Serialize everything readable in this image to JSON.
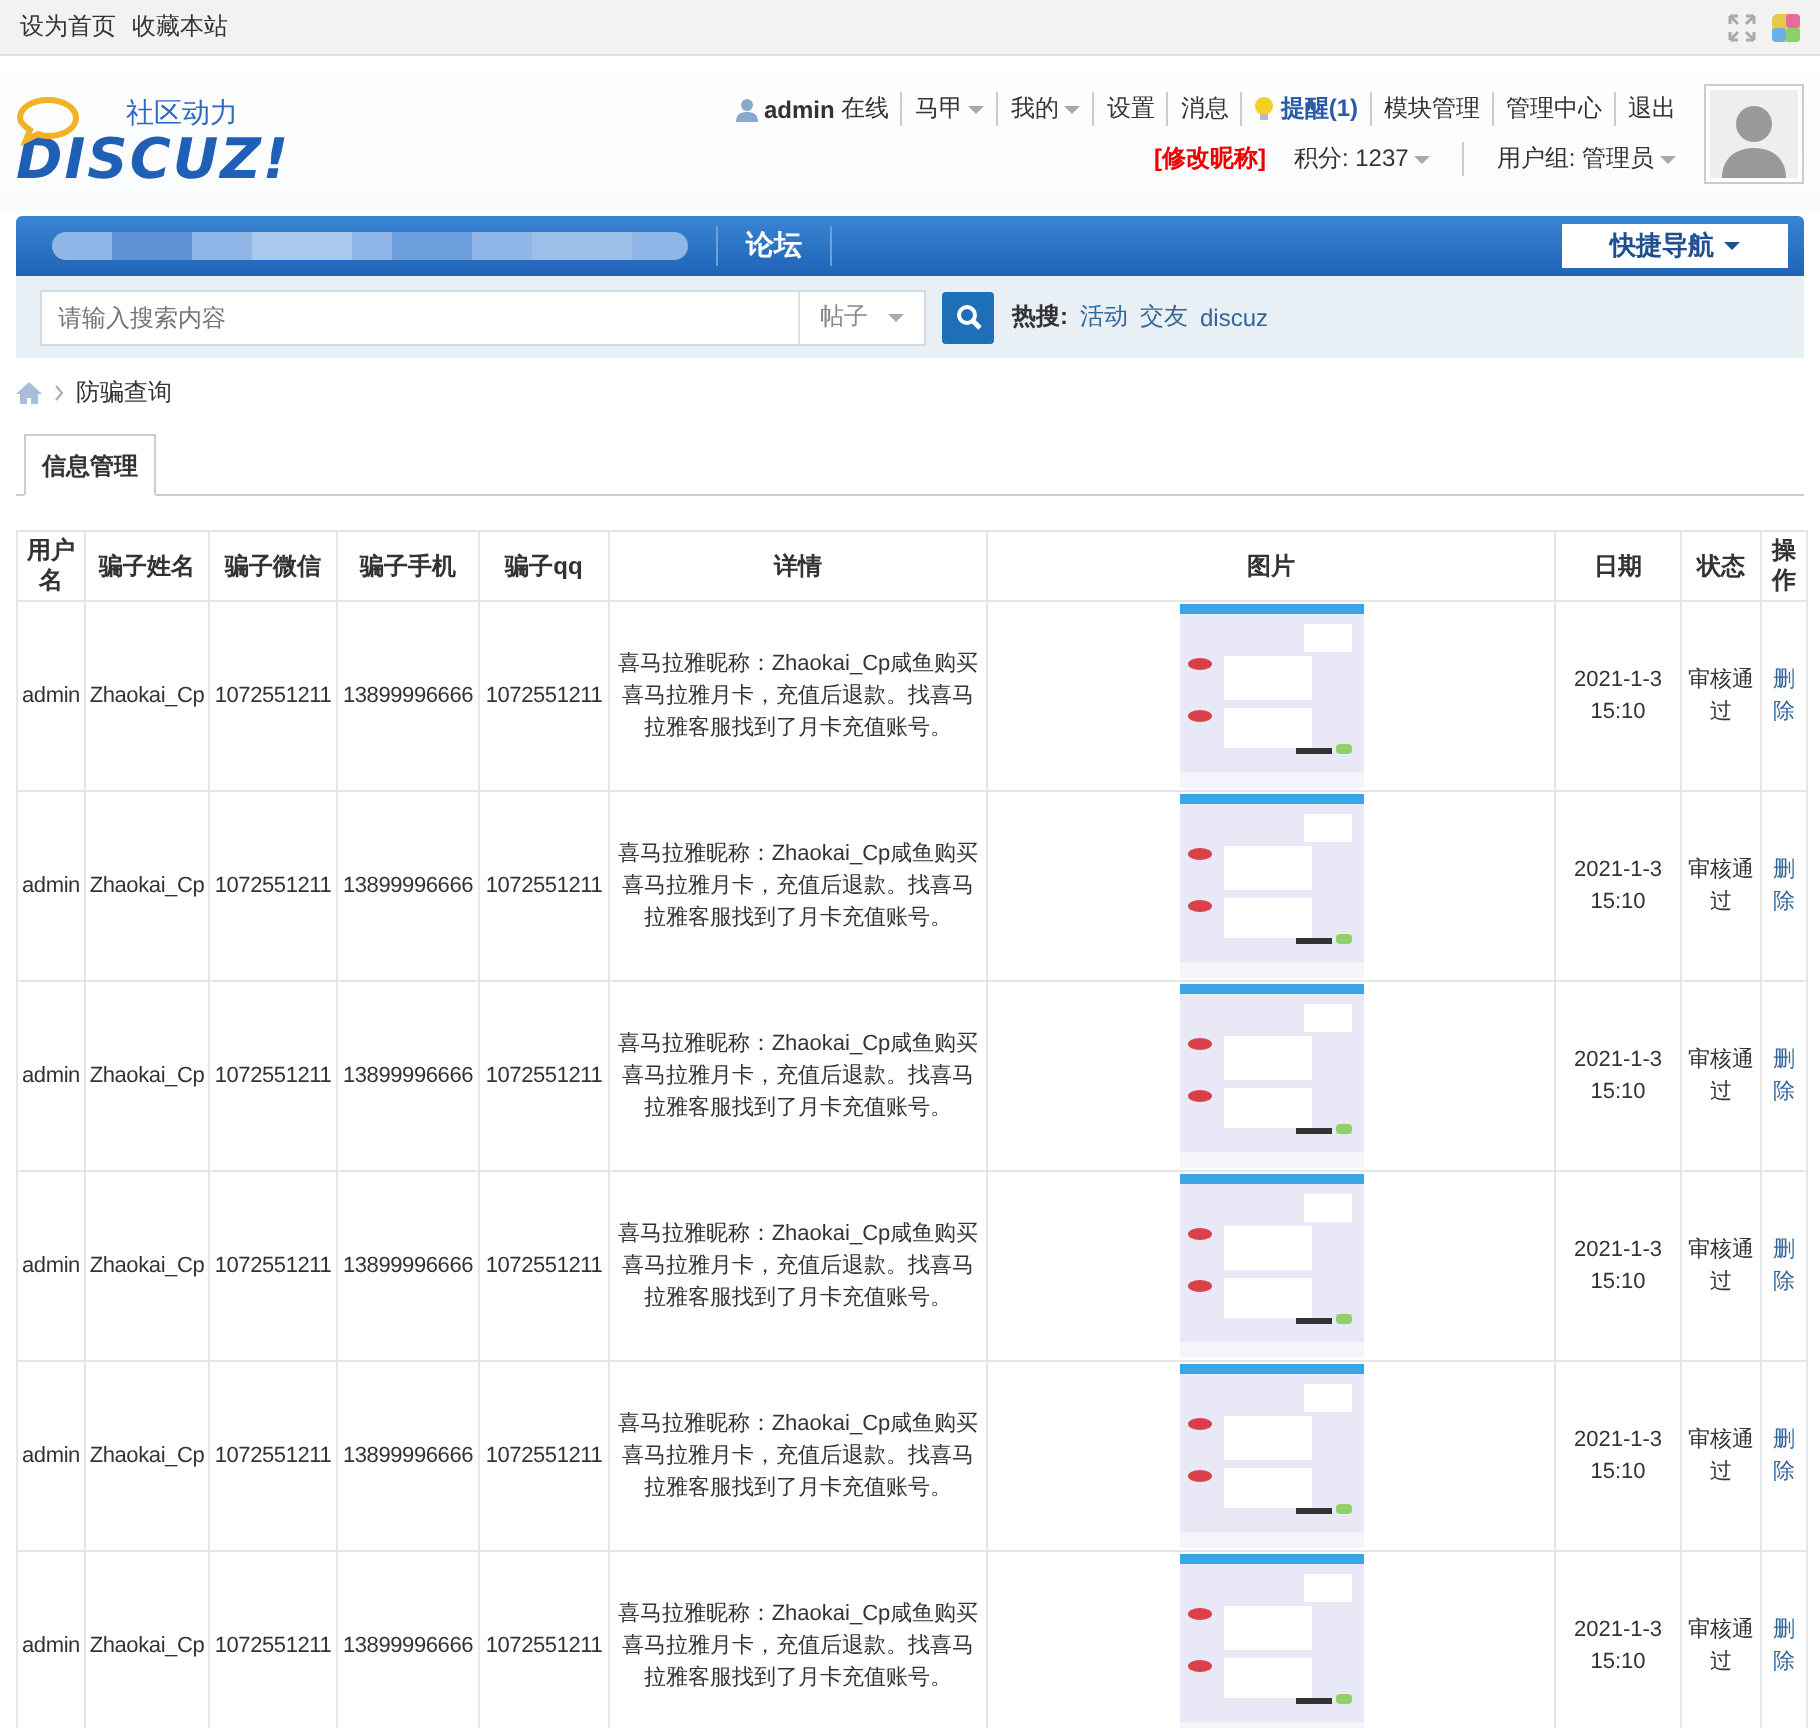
{
  "top_links": [
    "设为首页",
    "收藏本站"
  ],
  "header": {
    "logo_tagline": "社区动力",
    "logo_text": "DISCUZ!",
    "user_links": [
      {
        "kind": "user",
        "label": "admin",
        "suffix": "在线"
      },
      {
        "kind": "menu",
        "label": "马甲"
      },
      {
        "kind": "menu",
        "label": "我的"
      },
      {
        "kind": "link",
        "label": "设置"
      },
      {
        "kind": "link",
        "label": "消息"
      },
      {
        "kind": "alert",
        "label": "提醒(1)"
      },
      {
        "kind": "link",
        "label": "模块管理"
      },
      {
        "kind": "link",
        "label": "管理中心"
      },
      {
        "kind": "link",
        "label": "退出"
      }
    ],
    "edit_nickname": "[修改昵称]",
    "points": "积分: 1237",
    "usergroup": "用户组: 管理员"
  },
  "nav": {
    "forum": "论坛",
    "quick_nav": "快捷导航"
  },
  "search": {
    "placeholder": "请输入搜索内容",
    "type": "帖子",
    "hot_label": "热搜:",
    "hot_words": [
      "活动",
      "交友",
      "discuz"
    ]
  },
  "breadcrumb": [
    "防骗查询"
  ],
  "tabs": [
    {
      "label": "信息管理",
      "selected": true
    }
  ],
  "table": {
    "columns": [
      "用户名",
      "骗子姓名",
      "骗子微信",
      "骗子手机",
      "骗子qq",
      "详情",
      "图片",
      "日期",
      "状态",
      "操作"
    ],
    "rows": [
      {
        "username": "admin",
        "name": "Zhaokai_Cp",
        "wechat": "1072551211",
        "phone": "13899996666",
        "qq": "1072551211",
        "detail": "喜马拉雅昵称：Zhaokai_Cp咸鱼购买喜马拉雅月卡，充值后退款。找喜马拉雅客服找到了月卡充值账号。",
        "date": "2021-1-3 15:10",
        "status": "审核通过",
        "action": "删除"
      },
      {
        "username": "admin",
        "name": "Zhaokai_Cp",
        "wechat": "1072551211",
        "phone": "13899996666",
        "qq": "1072551211",
        "detail": "喜马拉雅昵称：Zhaokai_Cp咸鱼购买喜马拉雅月卡，充值后退款。找喜马拉雅客服找到了月卡充值账号。",
        "date": "2021-1-3 15:10",
        "status": "审核通过",
        "action": "删除"
      },
      {
        "username": "admin",
        "name": "Zhaokai_Cp",
        "wechat": "1072551211",
        "phone": "13899996666",
        "qq": "1072551211",
        "detail": "喜马拉雅昵称：Zhaokai_Cp咸鱼购买喜马拉雅月卡，充值后退款。找喜马拉雅客服找到了月卡充值账号。",
        "date": "2021-1-3 15:10",
        "status": "审核通过",
        "action": "删除"
      },
      {
        "username": "admin",
        "name": "Zhaokai_Cp",
        "wechat": "1072551211",
        "phone": "13899996666",
        "qq": "1072551211",
        "detail": "喜马拉雅昵称：Zhaokai_Cp咸鱼购买喜马拉雅月卡，充值后退款。找喜马拉雅客服找到了月卡充值账号。",
        "date": "2021-1-3 15:10",
        "status": "审核通过",
        "action": "删除"
      },
      {
        "username": "admin",
        "name": "Zhaokai_Cp",
        "wechat": "1072551211",
        "phone": "13899996666",
        "qq": "1072551211",
        "detail": "喜马拉雅昵称：Zhaokai_Cp咸鱼购买喜马拉雅月卡，充值后退款。找喜马拉雅客服找到了月卡充值账号。",
        "date": "2021-1-3 15:10",
        "status": "审核通过",
        "action": "删除"
      },
      {
        "username": "admin",
        "name": "Zhaokai_Cp",
        "wechat": "1072551211",
        "phone": "13899996666",
        "qq": "1072551211",
        "detail": "喜马拉雅昵称：Zhaokai_Cp咸鱼购买喜马拉雅月卡，充值后退款。找喜马拉雅客服找到了月卡充值账号。",
        "date": "2021-1-3 15:10",
        "status": "审核通过",
        "action": "删除"
      }
    ]
  }
}
